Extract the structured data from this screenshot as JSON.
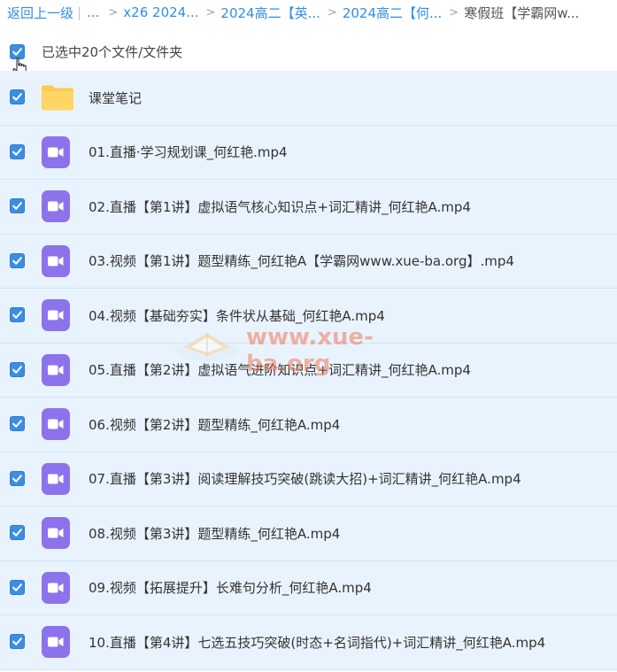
{
  "breadcrumb": {
    "back": "返回上一级",
    "separator": "|",
    "ellipsis": "...",
    "items": [
      "x26 2024...",
      "2024高二【英...",
      "2024高二【何..."
    ],
    "current": "寒假班【学霸网w..."
  },
  "selection": {
    "label": "已选中20个文件/文件夹"
  },
  "files": [
    {
      "name": "课堂笔记",
      "type": "folder"
    },
    {
      "name": "01.直播·学习规划课_何红艳.mp4",
      "type": "video"
    },
    {
      "name": "02.直播【第1讲】虚拟语气核心知识点+词汇精讲_何红艳A.mp4",
      "type": "video"
    },
    {
      "name": "03.视频【第1讲】题型精练_何红艳A【学霸网www.xue-ba.org】.mp4",
      "type": "video"
    },
    {
      "name": "04.视频【基础夯实】条件状从基础_何红艳A.mp4",
      "type": "video"
    },
    {
      "name": "05.直播【第2讲】虚拟语气进阶知识点+词汇精讲_何红艳A.mp4",
      "type": "video"
    },
    {
      "name": "06.视频【第2讲】题型精练_何红艳A.mp4",
      "type": "video"
    },
    {
      "name": "07.直播【第3讲】阅读理解技巧突破(跳读大招)+词汇精讲_何红艳A.mp4",
      "type": "video"
    },
    {
      "name": "08.视频【第3讲】题型精练_何红艳A.mp4",
      "type": "video"
    },
    {
      "name": "09.视频【拓展提升】长难句分析_何红艳A.mp4",
      "type": "video"
    },
    {
      "name": "10.直播【第4讲】七选五技巧突破(时态+名词指代)+词汇精讲_何红艳A.mp4",
      "type": "video"
    }
  ],
  "watermark": {
    "text": "www.xue-ba.org"
  },
  "colors": {
    "accent": "#3b8ee0",
    "row_bg": "#e9f3fd",
    "video_icon": "#8c73ec",
    "folder_icon": "#ffc94d",
    "link": "#2f8fe6"
  },
  "icons": {
    "checkbox": "checkbox-checked-icon",
    "folder": "folder-icon",
    "video": "video-file-icon",
    "cursor": "hand-cursor-icon"
  }
}
